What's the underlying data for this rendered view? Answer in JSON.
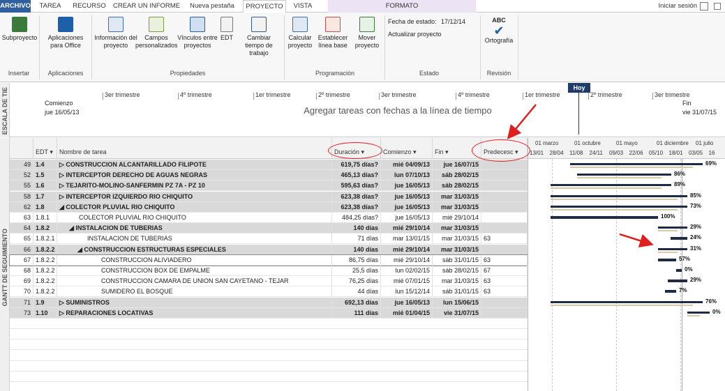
{
  "tabs": {
    "archivo": "ARCHIVO",
    "tarea": "TAREA",
    "recurso": "RECURSO",
    "informe": "CREAR UN INFORME",
    "nueva": "Nueva pestaña",
    "proyecto": "PROYECTO",
    "vista": "VISTA",
    "formato": "FORMATO"
  },
  "signin": "Iniciar sesión",
  "ribbon": {
    "subproyecto": "Subproyecto",
    "apps": "Aplicaciones para Office",
    "info": "Información del proyecto",
    "campos": "Campos personalizados",
    "vinculos": "Vínculos entre proyectos",
    "edt": "EDT",
    "cambiar": "Cambiar tiempo de trabajo",
    "calcular": "Calcular proyecto",
    "establecer": "Establecer línea base",
    "mover": "Mover proyecto",
    "fecha_estado": "Fecha de estado:",
    "fecha_estado_val": "17/12/14",
    "actualizar": "Actualizar proyecto",
    "abc": "ABC",
    "ortografia": "Ortografía",
    "g_insertar": "Insertar",
    "g_aplicaciones": "Aplicaciones",
    "g_propiedades": "Propiedades",
    "g_programacion": "Programación",
    "g_estado": "Estado",
    "g_revision": "Revisión"
  },
  "timeline": {
    "side_label": "ESCALA DE TIE",
    "hoy": "Hoy",
    "comienzo_label": "Comienzo",
    "comienzo_date": "jue 16/05/13",
    "fin_label": "Fin",
    "fin_date": "vie 31/07/15",
    "message": "Agregar tareas con fechas a la línea de tiempo",
    "quarters": [
      "3er trimestre",
      "4º trimestre",
      "1er trimestre",
      "2º trimestre",
      "3er trimestre",
      "4º trimestre",
      "1er trimestre",
      "2º trimestre",
      "3er trimestre"
    ]
  },
  "gantt": {
    "side_label": "GANTT DE SEGUIMIENTO",
    "headers": {
      "edt": "EDT",
      "nombre": "Nombre de tarea",
      "duracion": "Duración",
      "comienzo": "Comienzo",
      "fin": "Fin",
      "predecesoras": "Predecesc"
    },
    "rows": [
      {
        "id": "49",
        "edt": "1.4",
        "name": "▷ CONSTRUCCION ALCANTARILLADO FILIPOTE",
        "dur": "619,75 días?",
        "start": "mié 04/09/13",
        "end": "jue 16/07/15",
        "pred": ""
      },
      {
        "id": "52",
        "edt": "1.5",
        "name": "▷ INTERCEPTOR DERECHO DE AGUAS NEGRAS",
        "dur": "465,13 días?",
        "start": "lun 07/10/13",
        "end": "sáb 28/02/15",
        "pred": ""
      },
      {
        "id": "55",
        "edt": "1.6",
        "name": "▷ TEJARITO-MOLINO-SANFERMIN PZ 7A - PZ 10",
        "dur": "595,63 días?",
        "start": "jue 16/05/13",
        "end": "sáb 28/02/15",
        "pred": ""
      },
      {
        "id": "58",
        "edt": "1.7",
        "name": "▷ INTERCEPTOR IZQUIERDO RIO CHIQUITO",
        "dur": "623,38 días?",
        "start": "jue 16/05/13",
        "end": "mar 31/03/15",
        "pred": ""
      },
      {
        "id": "62",
        "edt": "1.8",
        "name": "◢ COLECTOR PLUVIAL RIO CHIQUITO",
        "dur": "623,38 días?",
        "start": "jue 16/05/13",
        "end": "mar 31/03/15",
        "pred": ""
      },
      {
        "id": "63",
        "edt": "1.8.1",
        "name": "COLECTOR PLUVIAL RIO CHIQUITO",
        "dur": "484,25 días?",
        "start": "jue 16/05/13",
        "end": "mié 29/10/14",
        "pred": ""
      },
      {
        "id": "64",
        "edt": "1.8.2",
        "name": "◢ INSTALACION DE TUBERIAS",
        "dur": "140 días",
        "start": "mié 29/10/14",
        "end": "mar 31/03/15",
        "pred": ""
      },
      {
        "id": "65",
        "edt": "1.8.2.1",
        "name": "INSTALACION DE TUBERIAS",
        "dur": "71 días",
        "start": "mar 13/01/15",
        "end": "mar 31/03/15",
        "pred": "63"
      },
      {
        "id": "66",
        "edt": "1.8.2.2",
        "name": "◢ CONSTRUCCION ESTRUCTURAS ESPECIALES",
        "dur": "140 días",
        "start": "mié 29/10/14",
        "end": "mar 31/03/15",
        "pred": ""
      },
      {
        "id": "67",
        "edt": "1.8.2.2",
        "name": "CONSTRUCCION ALIVIADERO",
        "dur": "86,75 días",
        "start": "mié 29/10/14",
        "end": "sáb 31/01/15",
        "pred": "63"
      },
      {
        "id": "68",
        "edt": "1.8.2.2",
        "name": "CONSTRUCCION BOX DE EMPALME",
        "dur": "25,5 días",
        "start": "lun 02/02/15",
        "end": "sáb 28/02/15",
        "pred": "67"
      },
      {
        "id": "69",
        "edt": "1.8.2.2",
        "name": "CONSTRUCCION CAMARA DE UNION SAN CAYETANO - TEJAR",
        "dur": "76,25 días",
        "start": "mié 07/01/15",
        "end": "mar 31/03/15",
        "pred": "63"
      },
      {
        "id": "70",
        "edt": "1.8.2.2",
        "name": "SUMIDERO EL BOSQUE",
        "dur": "44 días",
        "start": "lun 15/12/14",
        "end": "sáb 31/01/15",
        "pred": "63"
      },
      {
        "id": "71",
        "edt": "1.9",
        "name": "▷ SUMINISTROS",
        "dur": "692,13 días",
        "start": "jue 16/05/13",
        "end": "lun 15/06/15",
        "pred": ""
      },
      {
        "id": "73",
        "edt": "1.10",
        "name": "▷ REPARACIONES LOCATIVAS",
        "dur": "111 días",
        "start": "mié 01/04/15",
        "end": "vie 31/07/15",
        "pred": ""
      }
    ]
  },
  "chart": {
    "top_labels": [
      "01 marzo",
      "01 octubre",
      "01 mayo",
      "01 diciembre",
      "01 julio"
    ],
    "bottom_labels": [
      "13/01",
      "28/04",
      "11/08",
      "24/11",
      "09/03",
      "22/06",
      "05/10",
      "18/01",
      "03/05",
      "16"
    ],
    "pcts": [
      "69%",
      "86%",
      "89%",
      "85%",
      "73%",
      "100%",
      "29%",
      "24%",
      "31%",
      "57%",
      "0%",
      "29%",
      "7%",
      "76%",
      "0%"
    ]
  },
  "colors": {
    "accent": "#2f5f9e",
    "bar": "#1f2a44",
    "baseline": "#d8c9a5",
    "annotation": "#e01e1e",
    "today_line": "#d99a6c"
  }
}
